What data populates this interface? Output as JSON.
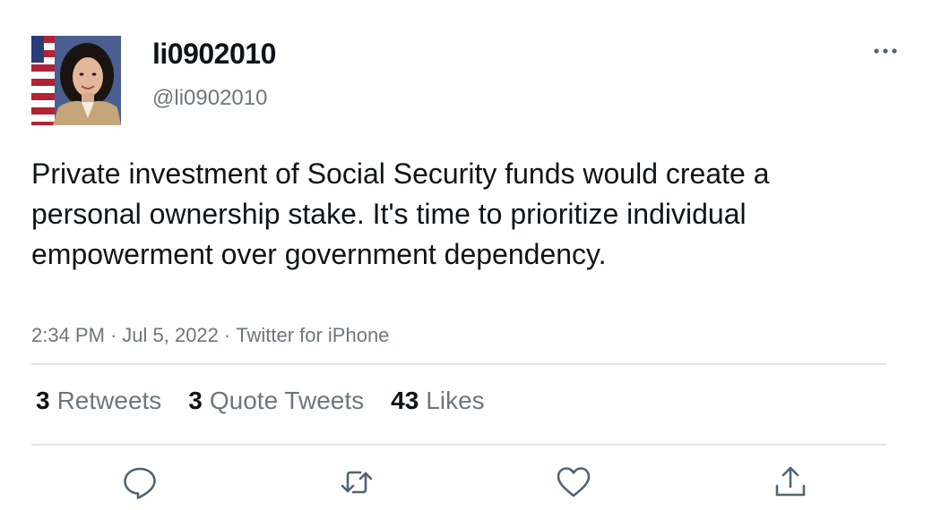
{
  "author": {
    "display_name": "li0902010",
    "handle": "@li0902010",
    "avatar_icon": "profile-photo"
  },
  "tweet": {
    "text": "Private investment of Social Security funds would create a personal ownership stake. It's time to prioritize individual empowerment over government dependency.",
    "time": "2:34 PM",
    "separator": "·",
    "date": "Jul 5, 2022",
    "source": "Twitter for iPhone"
  },
  "stats": {
    "retweets_count": "3",
    "retweets_label": "Retweets",
    "quotes_count": "3",
    "quotes_label": "Quote Tweets",
    "likes_count": "43",
    "likes_label": "Likes"
  },
  "actions": {
    "reply_icon": "reply-icon",
    "retweet_icon": "retweet-icon",
    "like_icon": "heart-icon",
    "share_icon": "share-icon",
    "more_icon": "more-icon"
  },
  "colors": {
    "text_primary": "#0f1419",
    "text_secondary": "#6e767d",
    "divider": "#dfe3e6",
    "icon": "#536471"
  }
}
